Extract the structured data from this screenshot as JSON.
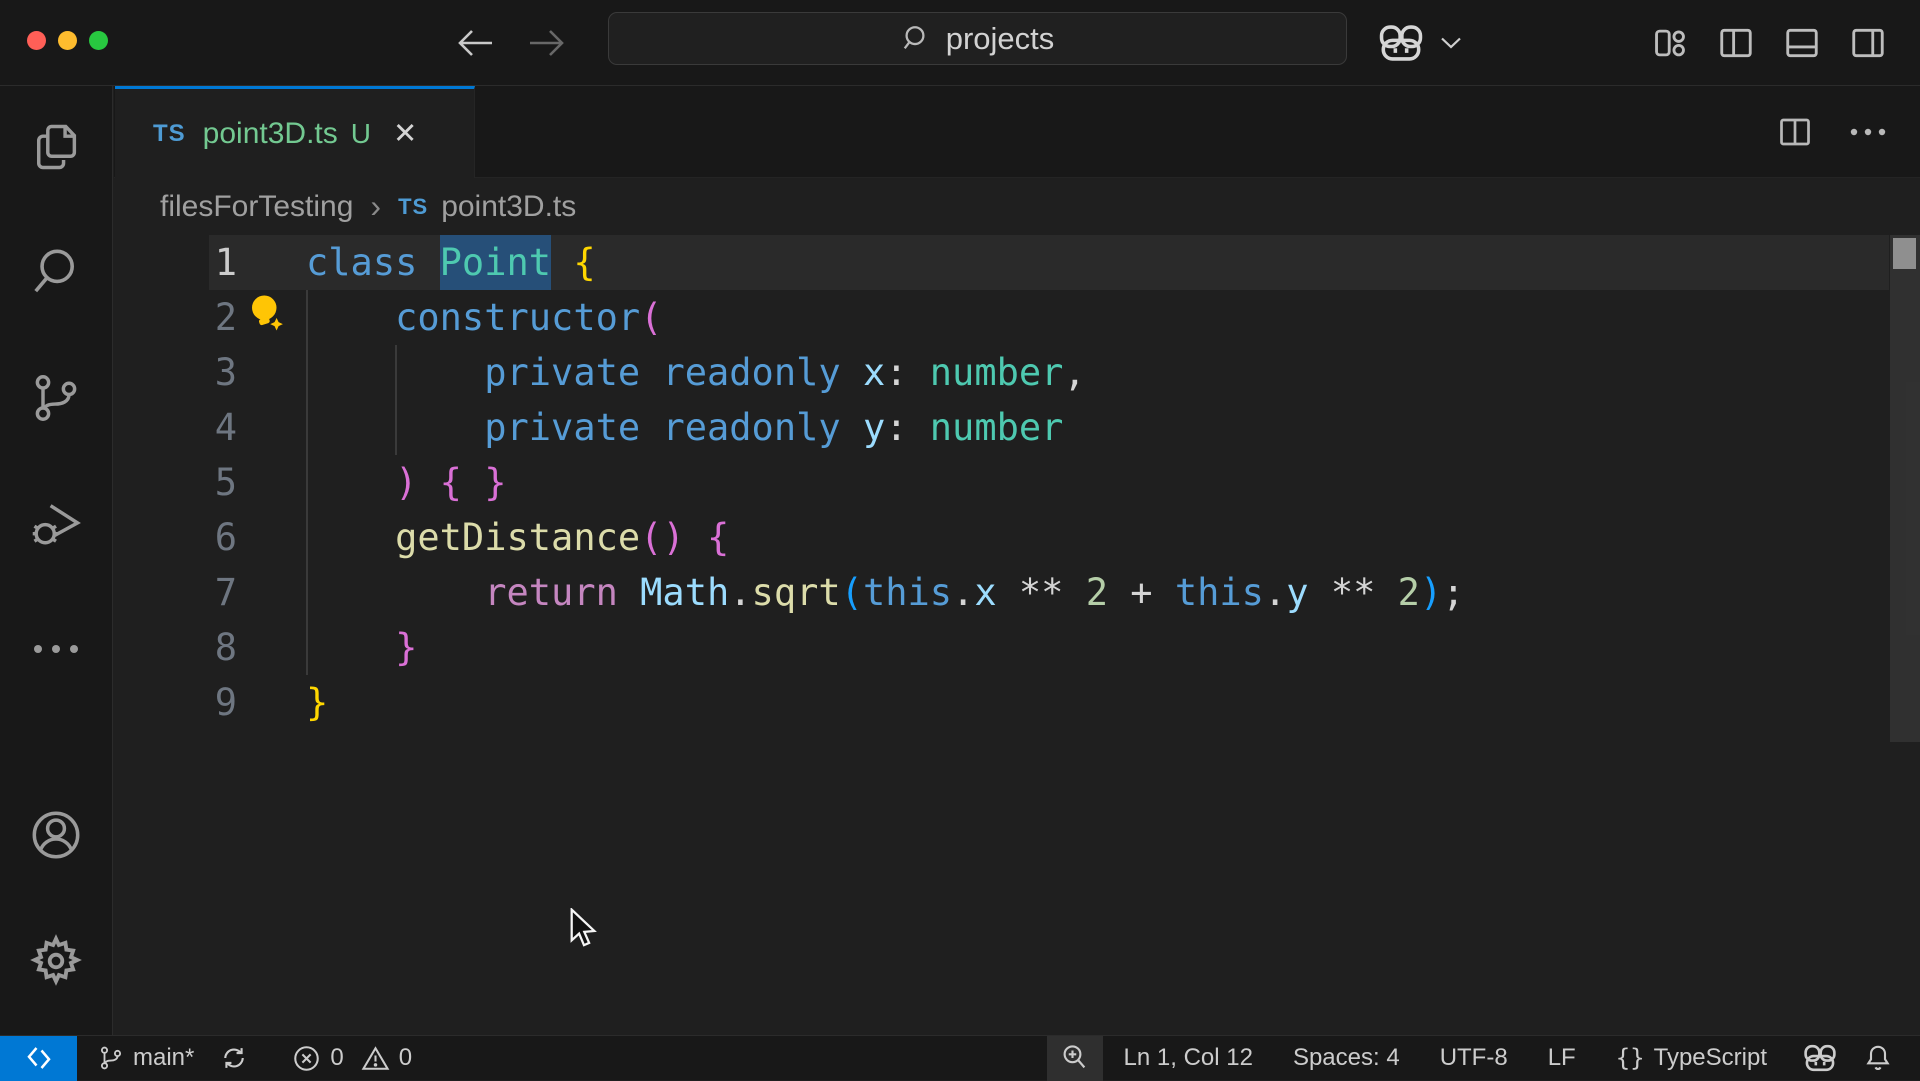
{
  "window": {
    "traffic_lights": [
      {
        "name": "close",
        "color": "#ff5f57"
      },
      {
        "name": "minimize",
        "color": "#febc2e"
      },
      {
        "name": "maximize",
        "color": "#28c840"
      }
    ],
    "command_center": {
      "query": "projects"
    },
    "layout_controls": [
      "customize-layout",
      "toggle-primary-sidebar",
      "toggle-panel",
      "toggle-secondary-sidebar"
    ]
  },
  "activity_bar": {
    "items": [
      "explorer",
      "search",
      "source-control",
      "run-and-debug",
      "more-views"
    ],
    "bottom_items": [
      "accounts",
      "settings"
    ]
  },
  "editor": {
    "tab": {
      "type_icon": "TS",
      "label": "point3D.ts",
      "modified_badge": "U",
      "close_glyph": "✕"
    },
    "breadcrumb": {
      "folder": "filesForTesting",
      "separator": "›",
      "file_type_icon": "TS",
      "file": "point3D.ts"
    },
    "palette": {
      "kw": "#569cd6",
      "ctrl": "#c586c0",
      "type": "#4ec9b0",
      "fn": "#dcdcaa",
      "var": "#9cdcfe",
      "num": "#b5cea8",
      "plain": "#d4d4d4",
      "b1": "#ffd700",
      "b2": "#da70d6",
      "b3": "#179fff"
    },
    "colors": {
      "accent": "#0078d4",
      "untracked_green": "#73c991",
      "word_highlight": "#264f78",
      "lightbulb": "#ffc505",
      "ts_icon_blue": "#4e9bd4"
    },
    "code": {
      "lines": [
        {
          "num": "1",
          "current": true,
          "tokens": [
            {
              "t": "class ",
              "c": "kw"
            },
            {
              "t": "Point",
              "c": "type",
              "hl": true
            },
            {
              "t": " ",
              "c": "plain"
            },
            {
              "t": "{",
              "c": "b1"
            }
          ]
        },
        {
          "num": "2",
          "tokens": [
            {
              "t": "    ",
              "c": "plain"
            },
            {
              "t": "constructor",
              "c": "kw"
            },
            {
              "t": "(",
              "c": "b2"
            }
          ]
        },
        {
          "num": "3",
          "tokens": [
            {
              "t": "        ",
              "c": "plain"
            },
            {
              "t": "private",
              "c": "kw"
            },
            {
              "t": " ",
              "c": "plain"
            },
            {
              "t": "readonly",
              "c": "kw"
            },
            {
              "t": " ",
              "c": "plain"
            },
            {
              "t": "x",
              "c": "var"
            },
            {
              "t": ":",
              "c": "plain"
            },
            {
              "t": " ",
              "c": "plain"
            },
            {
              "t": "number",
              "c": "type"
            },
            {
              "t": ",",
              "c": "plain"
            }
          ]
        },
        {
          "num": "4",
          "tokens": [
            {
              "t": "        ",
              "c": "plain"
            },
            {
              "t": "private",
              "c": "kw"
            },
            {
              "t": " ",
              "c": "plain"
            },
            {
              "t": "readonly",
              "c": "kw"
            },
            {
              "t": " ",
              "c": "plain"
            },
            {
              "t": "y",
              "c": "var"
            },
            {
              "t": ":",
              "c": "plain"
            },
            {
              "t": " ",
              "c": "plain"
            },
            {
              "t": "number",
              "c": "type"
            }
          ]
        },
        {
          "num": "5",
          "tokens": [
            {
              "t": "    ",
              "c": "plain"
            },
            {
              "t": ")",
              "c": "b2"
            },
            {
              "t": " ",
              "c": "plain"
            },
            {
              "t": "{",
              "c": "b2"
            },
            {
              "t": " ",
              "c": "plain"
            },
            {
              "t": "}",
              "c": "b2"
            }
          ]
        },
        {
          "num": "6",
          "tokens": [
            {
              "t": "    ",
              "c": "plain"
            },
            {
              "t": "getDistance",
              "c": "fn"
            },
            {
              "t": "(",
              "c": "b2"
            },
            {
              "t": ")",
              "c": "b2"
            },
            {
              "t": " ",
              "c": "plain"
            },
            {
              "t": "{",
              "c": "b2"
            }
          ]
        },
        {
          "num": "7",
          "tokens": [
            {
              "t": "        ",
              "c": "plain"
            },
            {
              "t": "return",
              "c": "ctrl"
            },
            {
              "t": " ",
              "c": "plain"
            },
            {
              "t": "Math",
              "c": "var"
            },
            {
              "t": ".",
              "c": "plain"
            },
            {
              "t": "sqrt",
              "c": "fn"
            },
            {
              "t": "(",
              "c": "b3"
            },
            {
              "t": "this",
              "c": "kw"
            },
            {
              "t": ".",
              "c": "plain"
            },
            {
              "t": "x",
              "c": "var"
            },
            {
              "t": " ",
              "c": "plain"
            },
            {
              "t": "**",
              "c": "plain"
            },
            {
              "t": " ",
              "c": "plain"
            },
            {
              "t": "2",
              "c": "num"
            },
            {
              "t": " ",
              "c": "plain"
            },
            {
              "t": "+",
              "c": "plain"
            },
            {
              "t": " ",
              "c": "plain"
            },
            {
              "t": "this",
              "c": "kw"
            },
            {
              "t": ".",
              "c": "plain"
            },
            {
              "t": "y",
              "c": "var"
            },
            {
              "t": " ",
              "c": "plain"
            },
            {
              "t": "**",
              "c": "plain"
            },
            {
              "t": " ",
              "c": "plain"
            },
            {
              "t": "2",
              "c": "num"
            },
            {
              "t": ")",
              "c": "b3"
            },
            {
              "t": ";",
              "c": "plain"
            }
          ]
        },
        {
          "num": "8",
          "tokens": [
            {
              "t": "    ",
              "c": "plain"
            },
            {
              "t": "}",
              "c": "b2"
            }
          ]
        },
        {
          "num": "9",
          "tokens": [
            {
              "t": "}",
              "c": "b1"
            }
          ]
        }
      ]
    }
  },
  "status_bar": {
    "branch": "main*",
    "errors": "0",
    "warnings": "0",
    "cursor_position": "Ln 1, Col 12",
    "indentation": "Spaces: 4",
    "encoding": "UTF-8",
    "eol": "LF",
    "language_icon": "{}",
    "language": "TypeScript"
  }
}
